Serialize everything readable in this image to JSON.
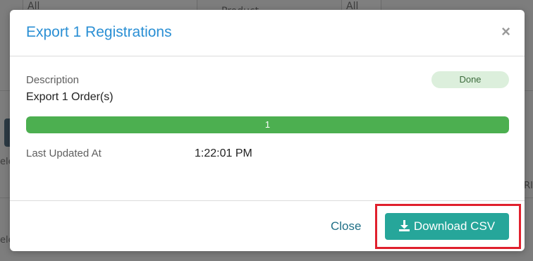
{
  "background": {
    "select_1": "All",
    "label_2": "Product",
    "select_3": "All",
    "left_text_1": "ele",
    "left_text_2": "ele",
    "right_text": "RI"
  },
  "modal": {
    "title": "Export 1 Registrations",
    "close_icon": "×",
    "description_label": "Description",
    "description_value": "Export 1 Order(s)",
    "status": "Done",
    "progress": {
      "label": "1",
      "fraction": 1.0
    },
    "last_updated_label": "Last Updated At",
    "last_updated_value": "1:22:01 PM",
    "footer": {
      "close_label": "Close",
      "download_label": "Download CSV",
      "download_icon": "download-icon"
    }
  },
  "colors": {
    "title": "#2a8fd4",
    "progress_fill": "#4caf50",
    "download_button": "#26a69a",
    "highlight": "#e0202d",
    "status_badge_bg": "#dcefdc"
  }
}
